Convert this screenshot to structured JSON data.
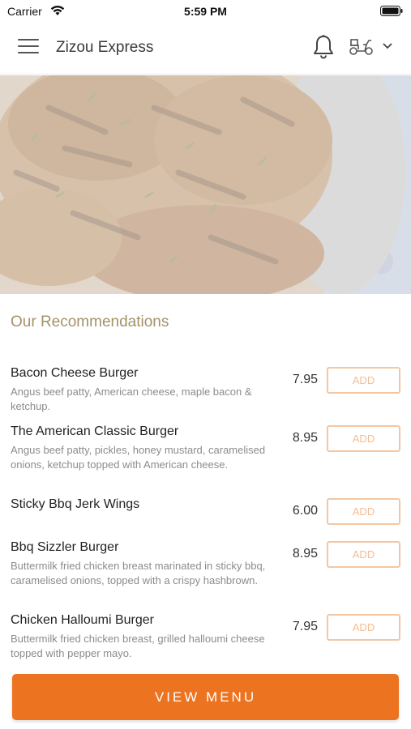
{
  "status_bar": {
    "carrier": "Carrier",
    "time": "5:59 PM"
  },
  "header": {
    "title": "Zizou Express",
    "icons": [
      "menu-icon",
      "bell-icon",
      "delivery-scooter-icon",
      "chevron-down-icon"
    ]
  },
  "section": {
    "title": "Our Recommendations"
  },
  "items": [
    {
      "name": "Bacon Cheese Burger",
      "description": "Angus beef patty, American cheese, maple bacon & ketchup.",
      "price": "7.95",
      "button": "ADD"
    },
    {
      "name": "The American Classic Burger",
      "description": "Angus beef patty, pickles, honey mustard, caramelised onions, ketchup topped with American cheese.",
      "price": "8.95",
      "button": "ADD"
    },
    {
      "name": "Sticky Bbq Jerk Wings",
      "description": "",
      "price": "6.00",
      "button": "ADD"
    },
    {
      "name": "Bbq Sizzler Burger",
      "description": "Buttermilk fried chicken breast marinated in sticky bbq, caramelised onions,  topped with a crispy hashbrown.",
      "price": "8.95",
      "button": "ADD"
    },
    {
      "name": "Chicken Halloumi Burger",
      "description": "Buttermilk fried chicken breast, grilled halloumi cheese topped with pepper mayo.",
      "price": "7.95",
      "button": "ADD"
    }
  ],
  "footer": {
    "view_menu_label": "VIEW MENU"
  },
  "colors": {
    "accent": "#ec7320",
    "section_title": "#a49269",
    "add_border": "#f3c7a3"
  }
}
